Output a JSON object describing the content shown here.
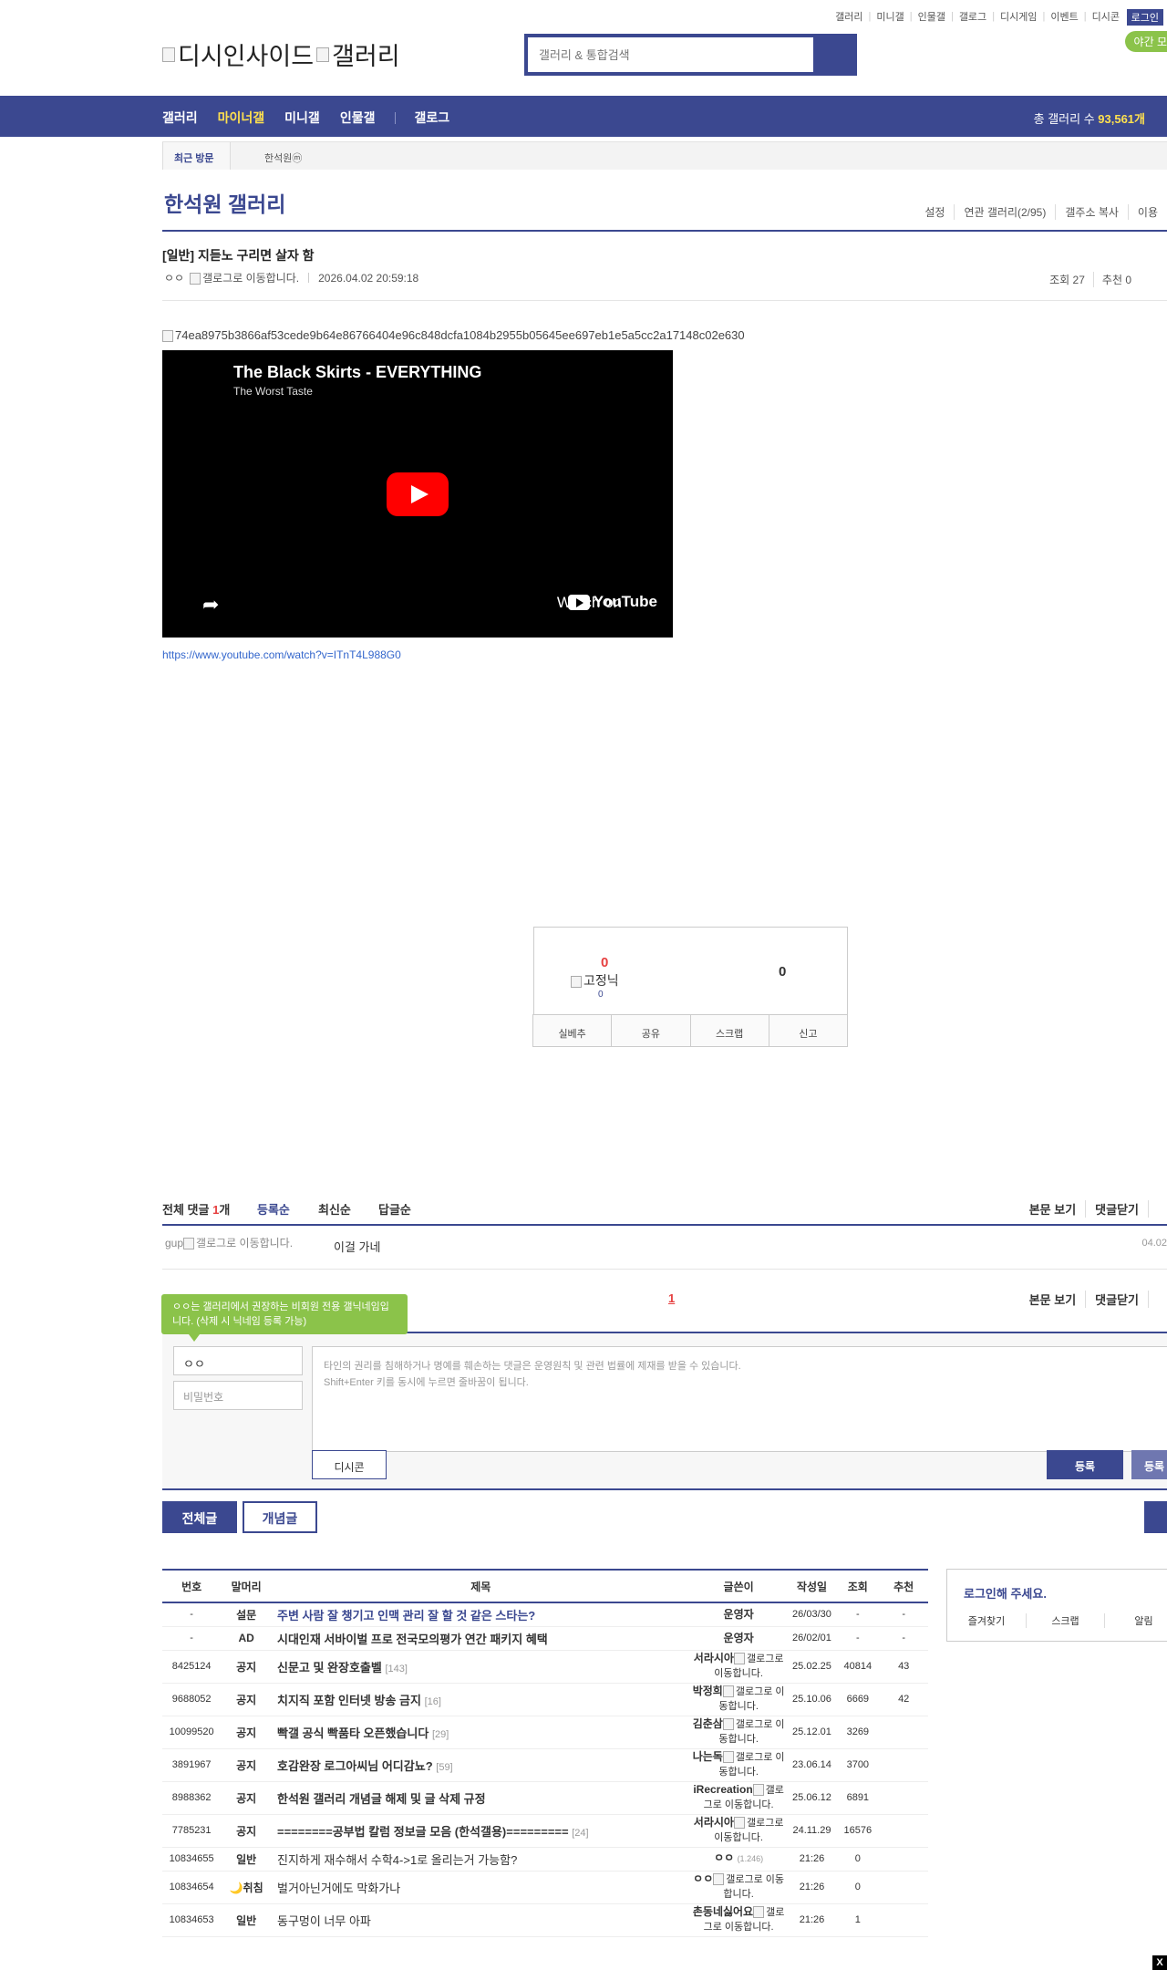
{
  "util": {
    "links": [
      "갤러리",
      "미니갤",
      "인물갤",
      "갤로그",
      "디시게임",
      "이벤트",
      "디시콘"
    ],
    "login": "로그인",
    "night_mode": "야간 모"
  },
  "logo": {
    "alt1": "디시인사이드",
    "alt2": "갤러리"
  },
  "search": {
    "placeholder": "갤러리 & 통합검색"
  },
  "gnb": {
    "items": [
      "갤러리",
      "마이너갤",
      "미니갤",
      "인물갤",
      "갤로그"
    ],
    "count_label": "총 갤러리 수 ",
    "count_value": "93,561개"
  },
  "recent": {
    "label": "최근 방문",
    "item": "한석원ⓜ"
  },
  "gallery": {
    "title": "한석원 갤러리",
    "menu": [
      "설정",
      "연관 갤러리(2/95)",
      "갤주소 복사",
      "이용"
    ]
  },
  "post": {
    "title": "[일반] 지듣노 구리면 살자 함",
    "author": "ㅇㅇ",
    "gallog_alt": "갤로그로 이동합니다.",
    "date": "2026.04.02 20:59:18",
    "views": "조회 27",
    "recommends": "추천 0",
    "image_alt": "74ea8975b3866af53cede9b64e86766404e96c848dcfa1084b2955b05645ee697eb1e5a5cc2a17148c02e630",
    "link": "https://www.youtube.com/watch?v=ITnT4L988G0"
  },
  "youtube": {
    "title": "The Black Skirts - EVERYTHING",
    "channel": "The Worst Taste",
    "watch_on": "Watch on",
    "brand": "YouTube"
  },
  "recommend": {
    "up_count": "0",
    "fix_alt": "고정닉",
    "fix_count": "0",
    "down_count": "0",
    "buttons": [
      "실베추",
      "공유",
      "스크랩",
      "신고"
    ]
  },
  "comments": {
    "total_label": "전체 댓글 ",
    "total_count": "1",
    "total_unit": "개",
    "sorts": [
      "등록순",
      "최신순",
      "답글순"
    ],
    "right_links": [
      "본문 보기",
      "댓글닫기"
    ],
    "items": [
      {
        "nick": "gup",
        "gallog_alt": "갤로그로 이동합니다.",
        "text": "이걸 가네",
        "date": "04.02"
      }
    ],
    "page": "1"
  },
  "write": {
    "tooltip": "ㅇㅇ는 갤러리에서 권장하는 비회원 전용 갤닉네임입니다. (삭제 시 닉네임 등록 가능)",
    "nick": "ㅇㅇ",
    "password_placeholder": "비밀번호",
    "notice1": "타인의 권리를 침해하거나 명예를 훼손하는 댓글은 운영원칙 및 관련 법률에 제재를 받을 수 있습니다.",
    "notice2": "Shift+Enter 키를 동시에 누르면 줄바꿈이 됩니다.",
    "dccon": "디시콘",
    "submit": "등록",
    "submit2": "등록"
  },
  "tabs": {
    "all": "전체글",
    "recommended": "개념글"
  },
  "list": {
    "headers": [
      "번호",
      "말머리",
      "제목",
      "글쓴이",
      "작성일",
      "조회",
      "추천"
    ],
    "rows": [
      {
        "num": "-",
        "subj": "설문",
        "title": "주변 사람 잘 챙기고 인맥 관리 잘 할 것 같은 스타는?",
        "reply": "",
        "writer": "운영자",
        "ip": "",
        "gallog": false,
        "date": "26/03/30",
        "views": "-",
        "rec": "-",
        "type": "survey"
      },
      {
        "num": "-",
        "subj": "AD",
        "title": "시대인재 서바이벌 프로 전국모의평가 연간 패키지 혜택",
        "reply": "",
        "writer": "운영자",
        "ip": "",
        "gallog": false,
        "date": "26/02/01",
        "views": "-",
        "rec": "-",
        "type": "notice"
      },
      {
        "num": "8425124",
        "subj": "공지",
        "title": "신문고 및 완장호출벨",
        "reply": "[143]",
        "writer": "서라시아",
        "ip": "",
        "gallog": true,
        "date": "25.02.25",
        "views": "40814",
        "rec": "43",
        "type": "notice"
      },
      {
        "num": "9688052",
        "subj": "공지",
        "title": "치지직 포함 인터넷 방송 금지",
        "reply": "[16]",
        "writer": "박정희",
        "ip": "",
        "gallog": true,
        "date": "25.10.06",
        "views": "6669",
        "rec": "42",
        "type": "notice"
      },
      {
        "num": "10099520",
        "subj": "공지",
        "title": "빡갤 공식 빡품타 오픈했습니다",
        "reply": "[29]",
        "writer": "김춘삼",
        "ip": "",
        "gallog": true,
        "date": "25.12.01",
        "views": "3269",
        "rec": "",
        "type": "notice"
      },
      {
        "num": "3891967",
        "subj": "공지",
        "title": "호감완장 로그아씨님 어디감뇨?",
        "reply": "[59]",
        "writer": "나는독",
        "ip": "",
        "gallog": true,
        "date": "23.06.14",
        "views": "3700",
        "rec": "",
        "type": "notice"
      },
      {
        "num": "8988362",
        "subj": "공지",
        "title": "한석원 갤러리 개념글 해제 및 글 삭제 규정",
        "reply": "",
        "writer": "iRecreation",
        "ip": "",
        "gallog": true,
        "date": "25.06.12",
        "views": "6891",
        "rec": "",
        "type": "notice"
      },
      {
        "num": "7785231",
        "subj": "공지",
        "title": "========공부법 칼럼 정보글 모음 (한석갤용)=========",
        "reply": "[24]",
        "writer": "서라시아",
        "ip": "",
        "gallog": true,
        "date": "24.11.29",
        "views": "16576",
        "rec": "",
        "type": "notice"
      },
      {
        "num": "10834655",
        "subj": "일반",
        "title": "진지하게 재수해서 수학4->1로 올리는거 가능함?",
        "reply": "",
        "writer": "ㅇㅇ",
        "ip": "(1.246)",
        "gallog": false,
        "date": "21:26",
        "views": "0",
        "rec": "",
        "type": "normal"
      },
      {
        "num": "10834654",
        "subj": "🌙취침",
        "title": "벌거아닌거에도 막화가나",
        "reply": "",
        "writer": "ㅇㅇ",
        "ip": "",
        "gallog": true,
        "date": "21:26",
        "views": "0",
        "rec": "",
        "type": "normal"
      },
      {
        "num": "10834653",
        "subj": "일반",
        "title": "동구멍이 너무 아파",
        "reply": "",
        "writer": "촌동네싫어요",
        "ip": "",
        "gallog": true,
        "date": "21:26",
        "views": "1",
        "rec": "",
        "type": "normal"
      }
    ]
  },
  "side": {
    "message": "로그인해 주세요.",
    "buttons": [
      "즐겨찾기",
      "스크랩",
      "알림"
    ]
  },
  "close": "X"
}
